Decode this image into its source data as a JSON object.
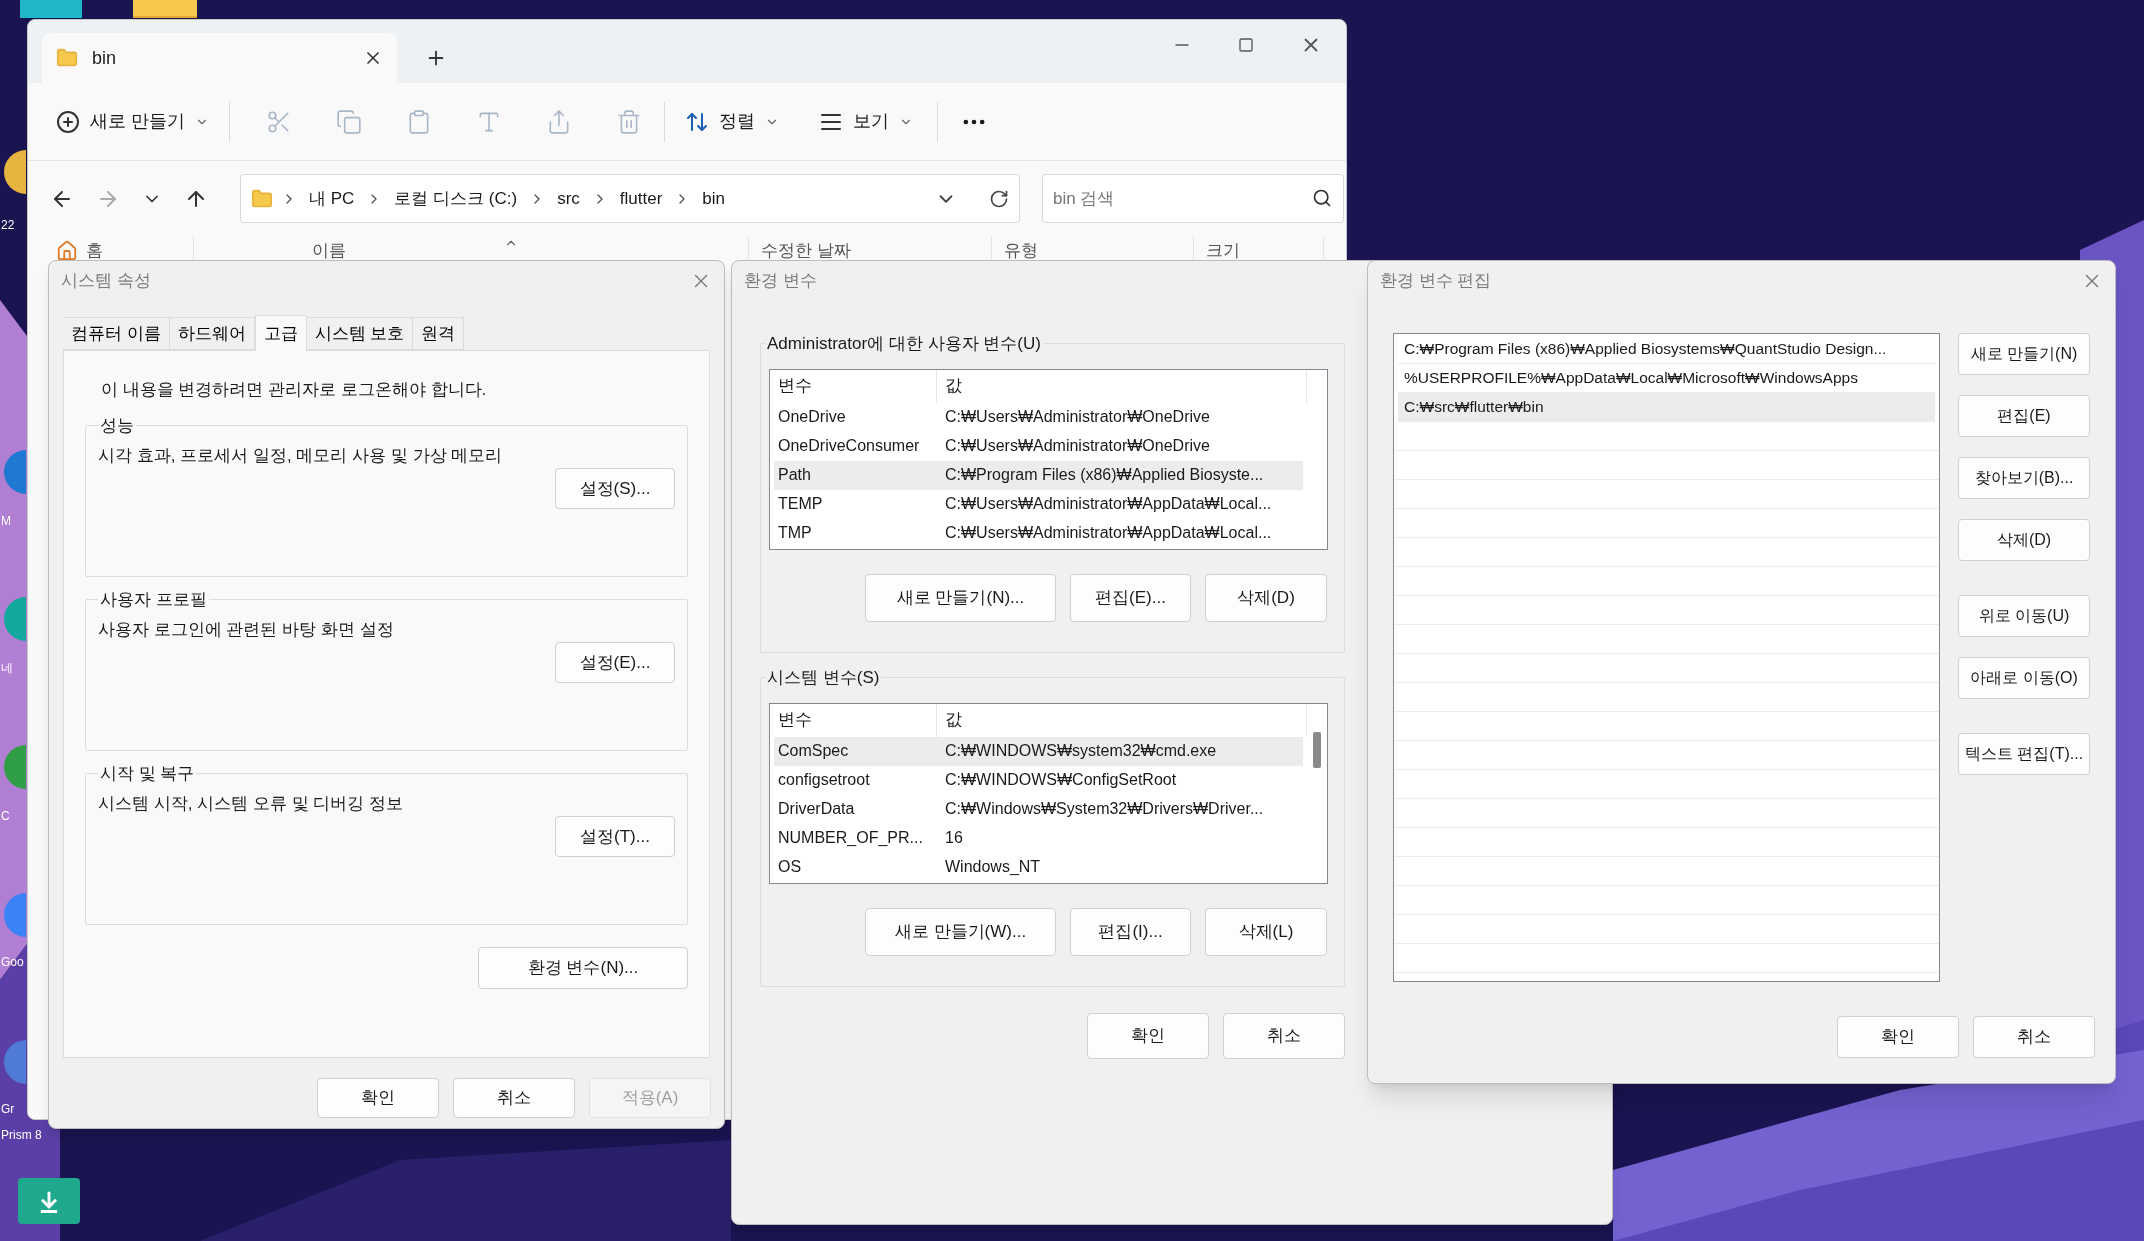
{
  "desktop": {
    "labels": [
      "22",
      "M",
      "네",
      "C",
      "Goo",
      "Gr",
      "Prism 8"
    ]
  },
  "explorer": {
    "tab_title": "bin",
    "new_button": "새로 만들기",
    "actions": [
      {
        "kind": "cut",
        "disabled": true
      },
      {
        "kind": "copy",
        "disabled": true
      },
      {
        "kind": "paste",
        "disabled": true
      },
      {
        "kind": "rename",
        "disabled": true
      },
      {
        "kind": "share",
        "disabled": true
      },
      {
        "kind": "delete",
        "disabled": true
      }
    ],
    "sort_button": "정렬",
    "view_button": "보기",
    "breadcrumbs": [
      "내 PC",
      "로컬 디스크 (C:)",
      "src",
      "flutter",
      "bin"
    ],
    "search": {
      "placeholder": "bin 검색"
    },
    "nav_item": "홈",
    "columns": [
      "이름",
      "수정한 날짜",
      "유형",
      "크기"
    ]
  },
  "system_properties": {
    "title": "시스템 속성",
    "tabs": [
      {
        "label": "컴퓨터 이름",
        "selected": false
      },
      {
        "label": "하드웨어",
        "selected": false
      },
      {
        "label": "고급",
        "selected": true
      },
      {
        "label": "시스템 보호",
        "selected": false
      },
      {
        "label": "원격",
        "selected": false
      }
    ],
    "notice": "이 내용을 변경하려면 관리자로 로그온해야 합니다.",
    "groups": [
      {
        "title": "성능",
        "description": "시각 효과, 프로세서 일정, 메모리 사용 및 가상 메모리",
        "button": "설정(S)..."
      },
      {
        "title": "사용자 프로필",
        "description": "사용자 로그인에 관련된 바탕 화면 설정",
        "button": "설정(E)..."
      },
      {
        "title": "시작 및 복구",
        "description": "시스템 시작, 시스템 오류 및 디버깅 정보",
        "button": "설정(T)..."
      }
    ],
    "env_button": "환경 변수(N)...",
    "buttons": [
      {
        "label": "확인",
        "disabled": false
      },
      {
        "label": "취소",
        "disabled": false
      },
      {
        "label": "적용(A)",
        "disabled": true
      }
    ]
  },
  "environment_variables": {
    "title": "환경 변수",
    "sections": [
      {
        "title": "Administrator에 대한 사용자 변수(U)",
        "columns": [
          "변수",
          "값"
        ],
        "rows": [
          {
            "name": "OneDrive",
            "value": "C:₩Users₩Administrator₩OneDrive",
            "selected": false
          },
          {
            "name": "OneDriveConsumer",
            "value": "C:₩Users₩Administrator₩OneDrive",
            "selected": false
          },
          {
            "name": "Path",
            "value": "C:₩Program Files (x86)₩Applied Biosyste...",
            "selected": true
          },
          {
            "name": "TEMP",
            "value": "C:₩Users₩Administrator₩AppData₩Local...",
            "selected": false
          },
          {
            "name": "TMP",
            "value": "C:₩Users₩Administrator₩AppData₩Local...",
            "selected": false
          }
        ],
        "buttons": [
          "새로 만들기(N)...",
          "편집(E)...",
          "삭제(D)"
        ]
      },
      {
        "title": "시스템 변수(S)",
        "columns": [
          "변수",
          "값"
        ],
        "rows": [
          {
            "name": "ComSpec",
            "value": "C:₩WINDOWS₩system32₩cmd.exe",
            "selected": true
          },
          {
            "name": "configsetroot",
            "value": "C:₩WINDOWS₩ConfigSetRoot",
            "selected": false
          },
          {
            "name": "DriverData",
            "value": "C:₩Windows₩System32₩Drivers₩Driver...",
            "selected": false
          },
          {
            "name": "NUMBER_OF_PR...",
            "value": "16",
            "selected": false
          },
          {
            "name": "OS",
            "value": "Windows_NT",
            "selected": false
          }
        ],
        "buttons": [
          "새로 만들기(W)...",
          "편집(I)...",
          "삭제(L)"
        ]
      }
    ],
    "buttons": [
      "확인",
      "취소"
    ]
  },
  "edit_environment_variable": {
    "title": "환경 변수 편집",
    "entries": [
      {
        "text": "C:₩Program Files (x86)₩Applied Biosystems₩QuantStudio Design...",
        "selected": false
      },
      {
        "text": "%USERPROFILE%₩AppData₩Local₩Microsoft₩WindowsApps",
        "selected": false
      },
      {
        "text": "C:₩src₩flutter₩bin",
        "selected": true
      }
    ],
    "button_groups": [
      [
        "새로 만들기(N)",
        "편집(E)",
        "찾아보기(B)...",
        "삭제(D)"
      ],
      [
        "위로 이동(U)",
        "아래로 이동(O)"
      ],
      [
        "텍스트 편집(T)..."
      ]
    ],
    "buttons": [
      "확인",
      "취소"
    ]
  }
}
